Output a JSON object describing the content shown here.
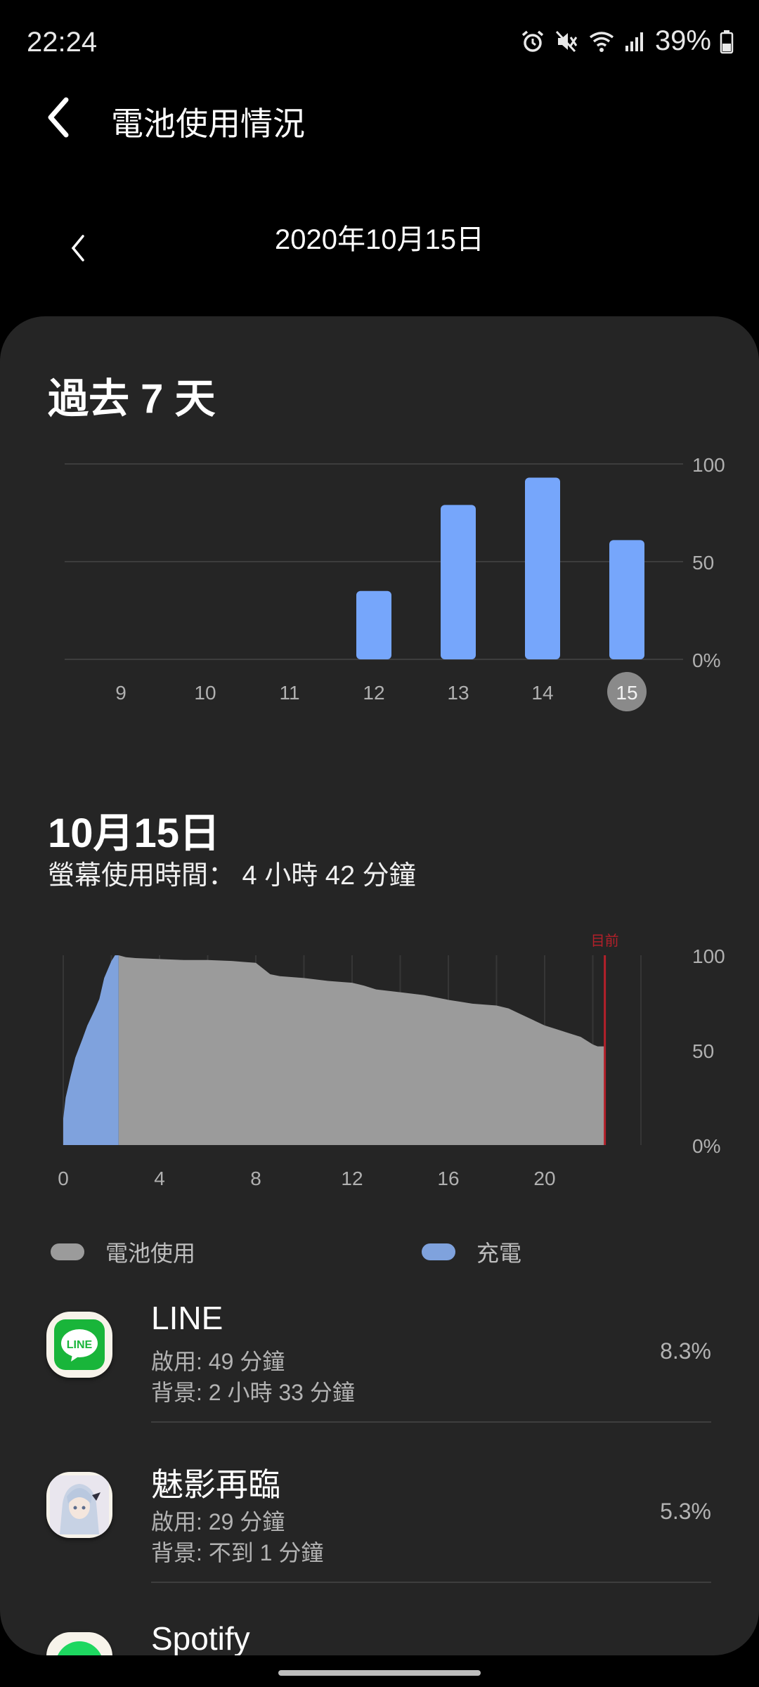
{
  "status_bar": {
    "time": "22:24",
    "battery_pct": "39%",
    "icons": [
      "alarm-icon",
      "mute-icon",
      "wifi-icon",
      "signal-icon",
      "battery-icon"
    ]
  },
  "header": {
    "title": "電池使用情況",
    "back_icon": "back-arrow-icon"
  },
  "date_nav": {
    "label": "2020年10月15日",
    "prev_icon": "chevron-left-icon"
  },
  "week_section": {
    "title": "過去 7 天"
  },
  "day_section": {
    "title": "10月15日",
    "screen_time": "螢幕使用時間： 4 小時 42 分鐘"
  },
  "legend": {
    "battery_use": "電池使用",
    "charging": "充電"
  },
  "colors": {
    "bar": "#76a6fb",
    "battery_fill": "#9b9b9b",
    "charge_fill": "#7fa2dd",
    "now_marker": "#b3202a",
    "card": "#252525"
  },
  "chart_data": [
    {
      "type": "bar",
      "categories": [
        "9",
        "10",
        "11",
        "12",
        "13",
        "14",
        "15"
      ],
      "values": [
        0,
        0,
        0,
        35,
        79,
        93,
        61
      ],
      "selected": "15",
      "y_ticks": [
        "100",
        "50",
        "0%"
      ],
      "ylim": [
        0,
        100
      ],
      "grid": true
    },
    {
      "type": "area",
      "x_ticks": [
        "0",
        "4",
        "8",
        "12",
        "16",
        "20"
      ],
      "y_ticks": [
        "100",
        "50",
        "0%"
      ],
      "xlim": [
        0,
        24
      ],
      "ylim": [
        0,
        100
      ],
      "now_label": "目前",
      "now_x": 22.5,
      "series": [
        {
          "name": "充電",
          "x": [
            0,
            0.1,
            0.3,
            0.5,
            0.8,
            1.0,
            1.3,
            1.5,
            1.7,
            2.0,
            2.15,
            2.3
          ],
          "y": [
            14,
            25,
            36,
            46,
            56,
            63,
            71,
            77,
            88,
            97,
            100,
            100
          ]
        },
        {
          "name": "電池使用",
          "x": [
            2.3,
            2.6,
            3,
            4,
            5,
            6,
            7,
            7.5,
            8,
            8.3,
            8.6,
            9,
            10,
            11,
            12,
            12.5,
            13,
            14,
            15,
            16,
            16.5,
            17,
            18,
            18.5,
            19,
            19.5,
            20,
            20.5,
            21,
            21.5,
            22,
            22.2,
            22.5
          ],
          "y": [
            100,
            99,
            98.5,
            98,
            97.5,
            97.5,
            97,
            96.5,
            96,
            93,
            90,
            89,
            88,
            86.5,
            85.5,
            84,
            82,
            80.5,
            79,
            76.5,
            75.5,
            74.5,
            73.5,
            72,
            69,
            66,
            63,
            61,
            59,
            57,
            53,
            52,
            52
          ]
        }
      ]
    }
  ],
  "apps": [
    {
      "name": "LINE",
      "foreground": "啟用: 49 分鐘",
      "background": "背景: 2 小時 33 分鐘",
      "percent": "8.3%",
      "icon": "line-app-icon",
      "icon_text": "LINE"
    },
    {
      "name": "魅影再臨",
      "foreground": "啟用: 29 分鐘",
      "background": "背景: 不到 1 分鐘",
      "percent": "5.3%",
      "icon": "game-app-icon"
    },
    {
      "name": "Spotify",
      "icon": "spotify-app-icon"
    }
  ]
}
